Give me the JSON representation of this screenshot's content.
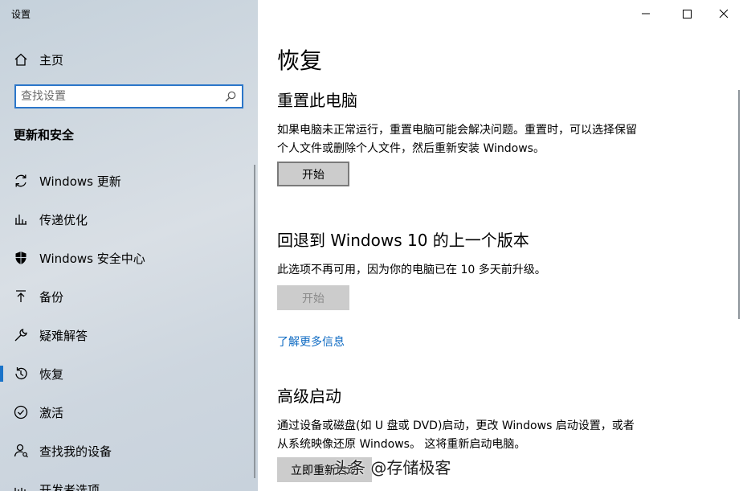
{
  "window": {
    "title": "设置"
  },
  "sidebar": {
    "home_label": "主页",
    "search_placeholder": "查找设置",
    "section_title": "更新和安全",
    "selected": "恢复",
    "items": [
      {
        "label": "Windows 更新",
        "icon": "refresh-icon"
      },
      {
        "label": "传递优化",
        "icon": "delivery-optimization-icon"
      },
      {
        "label": "Windows 安全中心",
        "icon": "shield-icon"
      },
      {
        "label": "备份",
        "icon": "backup-arrow-icon"
      },
      {
        "label": "疑难解答",
        "icon": "wrench-icon"
      },
      {
        "label": "恢复",
        "icon": "history-icon"
      },
      {
        "label": "激活",
        "icon": "check-circle-icon"
      },
      {
        "label": "查找我的设备",
        "icon": "person-locate-icon"
      },
      {
        "label": "开发者选项",
        "icon": "dev-tools-icon"
      }
    ]
  },
  "main": {
    "title": "恢复",
    "reset": {
      "heading": "重置此电脑",
      "description": "如果电脑未正常运行，重置电脑可能会解决问题。重置时，可以选择保留个人文件或删除个人文件，然后重新安装 Windows。",
      "button": "开始"
    },
    "rollback": {
      "heading": "回退到 Windows 10 的上一个版本",
      "description": "此选项不再可用，因为你的电脑已在 10 多天前升级。",
      "button": "开始"
    },
    "learn_more": "了解更多信息",
    "advanced": {
      "heading": "高级启动",
      "description": "通过设备或磁盘(如 U 盘或 DVD)启动，更改 Windows 启动设置，或者从系统映像还原 Windows。 这将重新启动电脑。",
      "button": "立即重新启动"
    }
  },
  "watermark": "头条 @存储极客",
  "colors": {
    "accent": "#0f6bc3",
    "selection_bar": "#1a73c9",
    "button_bg": "#cccccc"
  }
}
